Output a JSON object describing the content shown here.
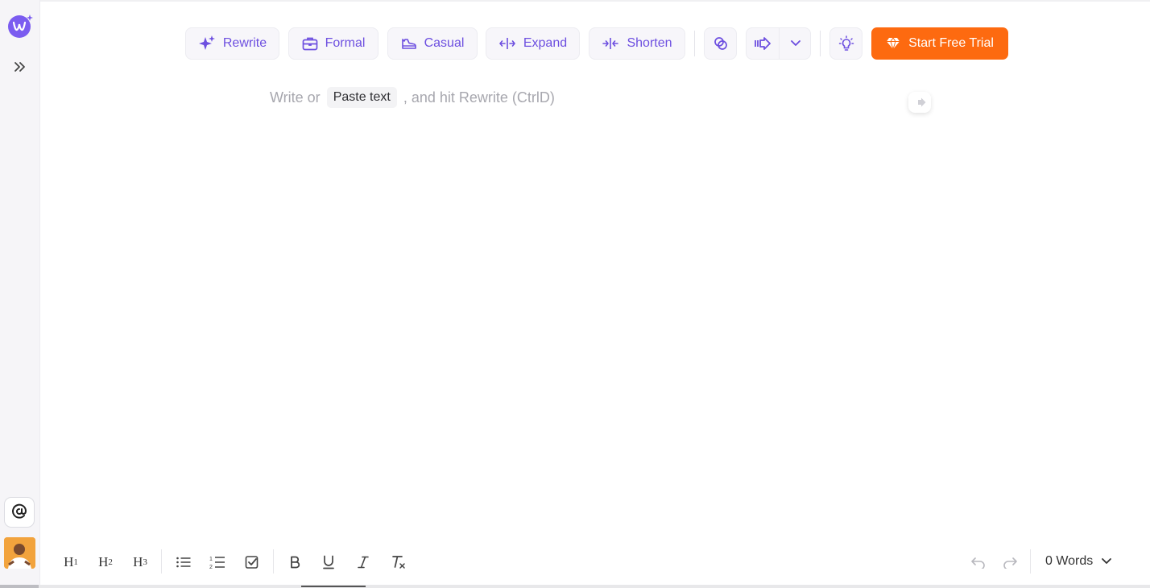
{
  "toolbar": {
    "rewrite": "Rewrite",
    "formal": "Formal",
    "casual": "Casual",
    "expand": "Expand",
    "shorten": "Shorten",
    "trial": "Start Free Trial"
  },
  "editor": {
    "placeholder_before": "Write or",
    "paste_chip": "Paste text",
    "placeholder_after": ", and hit Rewrite (CtrlD)"
  },
  "footer": {
    "h1": "H",
    "h1_sub": "1",
    "h2": "H",
    "h2_sub": "2",
    "h3": "H",
    "h3_sub": "3",
    "word_count": "0 Words"
  },
  "colors": {
    "accent": "#6d4fe0",
    "trial": "#fd6a10",
    "logo": "#7b5cf0"
  },
  "icons": [
    "logo-icon",
    "sparkle-icon",
    "briefcase-icon",
    "sneaker-icon",
    "expand-icon",
    "shorten-icon",
    "chain-icon",
    "arrow-right-icon",
    "chevron-down-icon",
    "lightbulb-icon",
    "diamond-icon",
    "double-chevron-icon",
    "at-icon"
  ]
}
